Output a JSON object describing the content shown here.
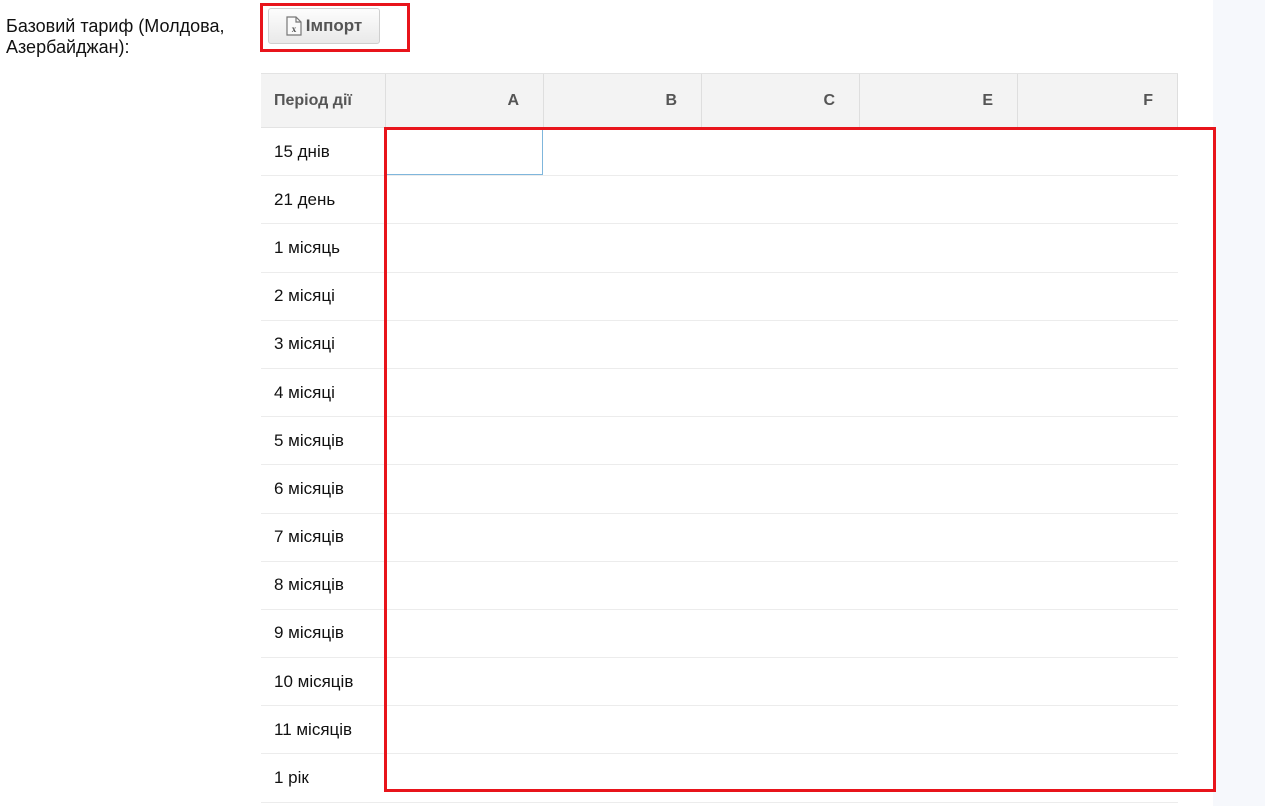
{
  "form": {
    "label_line1": "Базовий тариф (Молдова,",
    "label_line2": "Азербайджан):",
    "import_label": "Імпорт"
  },
  "icons": {
    "import": "excel-file-icon"
  },
  "colors": {
    "highlight": "#e8141b",
    "active_cell_border": "#7fb6dc"
  },
  "grid": {
    "header_period": "Період дії",
    "columns": [
      "A",
      "B",
      "C",
      "E",
      "F"
    ],
    "rows": [
      "15 днів",
      "21 день",
      "1 місяць",
      "2 місяці",
      "3 місяці",
      "4 місяці",
      "5 місяців",
      "6 місяців",
      "7 місяців",
      "8 місяців",
      "9 місяців",
      "10 місяців",
      "11 місяців",
      "1 рік"
    ],
    "active_cell": {
      "row": 0,
      "column": 0
    }
  }
}
